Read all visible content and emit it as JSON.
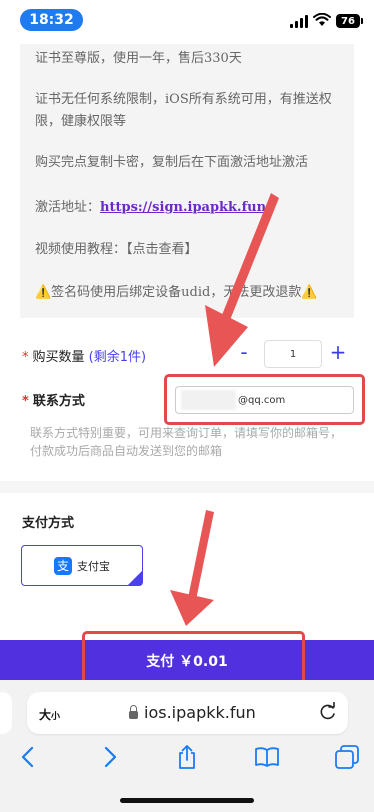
{
  "status_bar": {
    "time": "18:32",
    "battery": "76"
  },
  "description": {
    "lines": [
      "证书至尊版，使用一年，售后330天",
      "证书无任何系统限制，iOS所有系统可用，有推送权限，健康权限等",
      "购买完点复制卡密，复制后在下面激活地址激活",
      "激活地址：",
      "https://sign.ipapkk.fun/",
      "视频使用教程：【点击查看】",
      "⚠️签名码使用后绑定设备udid，无法更改退款⚠️"
    ]
  },
  "form": {
    "required_mark": "*",
    "quantity_label": "购买数量",
    "remaining": "(剩余1件)",
    "minus": "-",
    "plus": "+",
    "quantity_value": "1",
    "contact_label": "联系方式",
    "contact_value": "@qq.com",
    "hint": "联系方式特别重要，可用来查询订单，请填写你的邮箱号，付款成功后商品自动发送到您的邮箱"
  },
  "payment": {
    "title": "支付方式",
    "method_logo": "支",
    "method_label": "支付宝",
    "check": "✓",
    "pay_button": "支付 ￥0.01"
  },
  "browser": {
    "text_size": "大",
    "text_size_small": "小",
    "url": "ios.ipapkk.fun"
  },
  "colors": {
    "accent": "#5130e0",
    "annotation": "#e14a4a",
    "link": "#6b2ac7"
  }
}
